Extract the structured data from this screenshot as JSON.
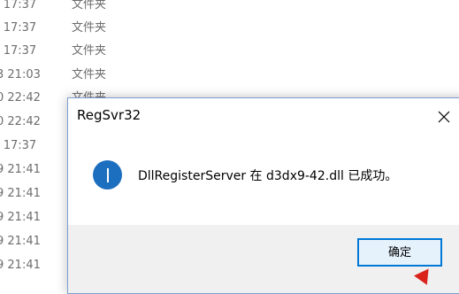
{
  "background_list": {
    "rows": [
      {
        "date": "l 17:37",
        "type": "文件夹"
      },
      {
        "date": "l 17:37",
        "type": "文件夹"
      },
      {
        "date": "l 17:37",
        "type": "文件夹"
      },
      {
        "date": "3 21:03",
        "type": "文件夹"
      },
      {
        "date": "0 22:42",
        "type": "文件夹"
      },
      {
        "date": "0 22:42",
        "type": ""
      },
      {
        "date": "l 17:37",
        "type": ""
      },
      {
        "date": "9 21:41",
        "type": ""
      },
      {
        "date": "9 21:41",
        "type": ""
      },
      {
        "date": "9 21:41",
        "type": ""
      },
      {
        "date": "9 21:41",
        "type": ""
      },
      {
        "date": "9 21:41",
        "type": ""
      }
    ]
  },
  "dialog": {
    "title": "RegSvr32",
    "close_icon": "close-icon",
    "info_icon": "info-icon",
    "message": "DllRegisterServer 在 d3dx9-42.dll 已成功。",
    "ok_label": "确定"
  },
  "colors": {
    "accent": "#0078d7",
    "info": "#1c6fbf",
    "footer": "#f0f0f0",
    "cursor": "#d9231b"
  }
}
